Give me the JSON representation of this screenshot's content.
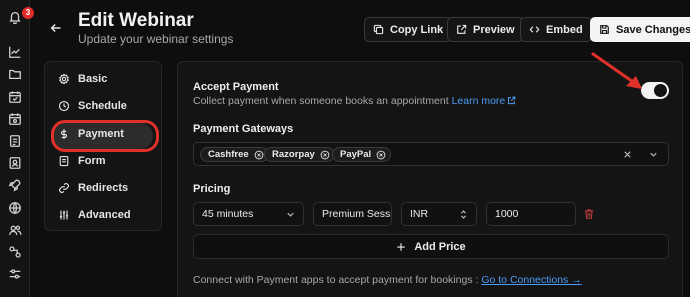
{
  "rail": {
    "badge_count": "3",
    "icons": [
      "bell-icon",
      "chart-icon",
      "folder-icon",
      "calendar-icon",
      "calendar-settings-icon",
      "document-icon",
      "contact-icon",
      "rocket-icon",
      "globe-icon",
      "users-icon",
      "integrations-icon",
      "sliders-icon"
    ]
  },
  "header": {
    "title": "Edit Webinar",
    "subtitle": "Update your webinar settings",
    "copy_link": "Copy Link",
    "preview": "Preview",
    "embed": "Embed",
    "save": "Save Changes"
  },
  "nav": {
    "items": [
      {
        "label": "Basic",
        "icon": "gear-icon"
      },
      {
        "label": "Schedule",
        "icon": "clock-icon"
      },
      {
        "label": "Payment",
        "icon": "dollar-icon",
        "active": true
      },
      {
        "label": "Form",
        "icon": "form-icon"
      },
      {
        "label": "Redirects",
        "icon": "link-icon"
      },
      {
        "label": "Advanced",
        "icon": "sliders-icon"
      }
    ]
  },
  "payment": {
    "accept_title": "Accept Payment",
    "accept_desc": "Collect payment when someone books an appointment",
    "learn_more": "Learn more",
    "toggle_on": true,
    "gateways_label": "Payment Gateways",
    "gateways": [
      "Cashfree",
      "Razorpay",
      "PayPal"
    ],
    "pricing_label": "Pricing",
    "pricing_row": {
      "duration": "45 minutes",
      "name": "Premium Session",
      "currency": "INR",
      "amount": "1000"
    },
    "add_price": "Add Price",
    "connect_text": "Connect with Payment apps to accept payment for bookings :",
    "connect_link": "Go to Connections →"
  },
  "colors": {
    "background": "#0e0e0e",
    "card": "#141414",
    "accent_link": "#4d9df7",
    "annotation_red": "#e0302a",
    "badge_red": "#e02b2b"
  }
}
